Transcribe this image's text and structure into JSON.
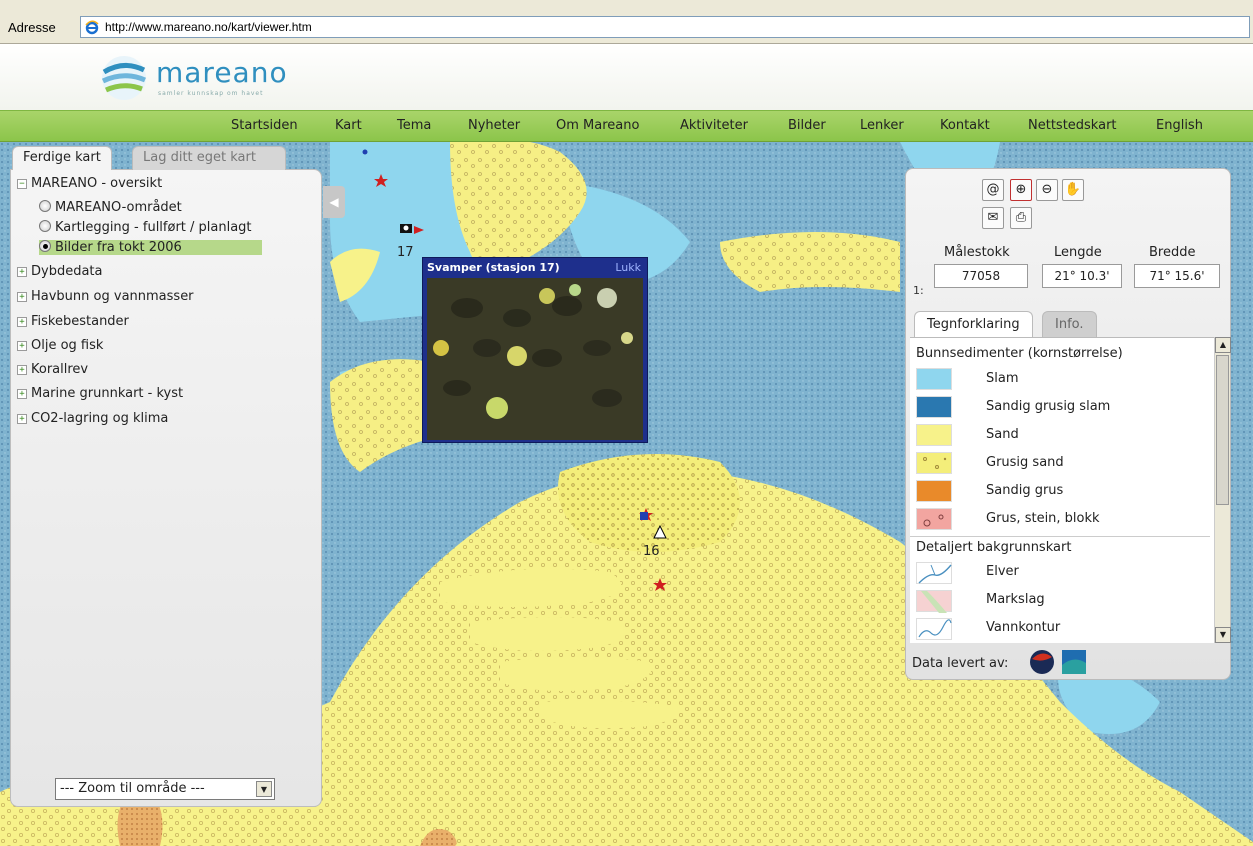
{
  "browser": {
    "address_label": "Adresse",
    "url": "http://www.mareano.no/kart/viewer.htm"
  },
  "site": {
    "logo_text": "mareano",
    "logo_tagline": "samler kunnskap om havet"
  },
  "nav": {
    "items": [
      "Startsiden",
      "Kart",
      "Tema",
      "Nyheter",
      "Om Mareano",
      "Aktiviteter",
      "Bilder",
      "Lenker",
      "Kontakt",
      "Nettstedskart",
      "English"
    ]
  },
  "left_panel": {
    "tabs": [
      "Ferdige kart",
      "Lag ditt eget kart"
    ],
    "tree": {
      "expanded_group": "MAREANO - oversikt",
      "radio_options": [
        "MAREANO-området",
        "Kartlegging - fullført / planlagt",
        "Bilder fra tokt 2006"
      ],
      "selected_option": "Bilder fra tokt 2006",
      "collapsed_groups": [
        "Dybdedata",
        "Havbunn og vannmasser",
        "Fiskebestander",
        "Olje og fisk",
        "Korallrev",
        "Marine grunnkart - kyst",
        "CO2-lagring og klima"
      ]
    },
    "zoom_select": "--- Zoom til område ---"
  },
  "map": {
    "station_labels": [
      "17",
      "16"
    ],
    "popup": {
      "title": "Svamper (stasjon 17)",
      "close_label": "Lukk"
    }
  },
  "right_panel": {
    "tools": [
      "at-icon",
      "zoom-in-icon",
      "zoom-out-icon",
      "pan-hand-icon",
      "mail-icon",
      "print-icon"
    ],
    "scale_label": "Målestokk",
    "scale_prefix": "1:",
    "scale_value": "77058",
    "length_label": "Lengde",
    "length_value": "21° 10.3'",
    "width_label": "Bredde",
    "width_value": "71° 15.6'",
    "tabs": [
      "Tegnforklaring",
      "Info."
    ],
    "legend": {
      "section1_title": "Bunnsedimenter (kornstørrelse)",
      "section1_items": [
        "Slam",
        "Sandig grusig slam",
        "Sand",
        "Grusig sand",
        "Sandig grus",
        "Grus, stein, blokk"
      ],
      "section2_title": "Detaljert bakgrunnskart",
      "section2_items": [
        "Elver",
        "Markslag",
        "Vannkontur"
      ]
    },
    "data_source_label": "Data levert av:"
  },
  "colors": {
    "nav_green": "#8cc54a",
    "slam": "#8fd6ee",
    "sandig_grusig_slam": "#2a78b0",
    "sand": "#f7f28a",
    "grusig_sand": "#f4ee7a",
    "sandig_grus": "#e98a2a",
    "grus_stein_blokk": "#f2a5a0",
    "popup_blue": "#1e2f8c"
  }
}
